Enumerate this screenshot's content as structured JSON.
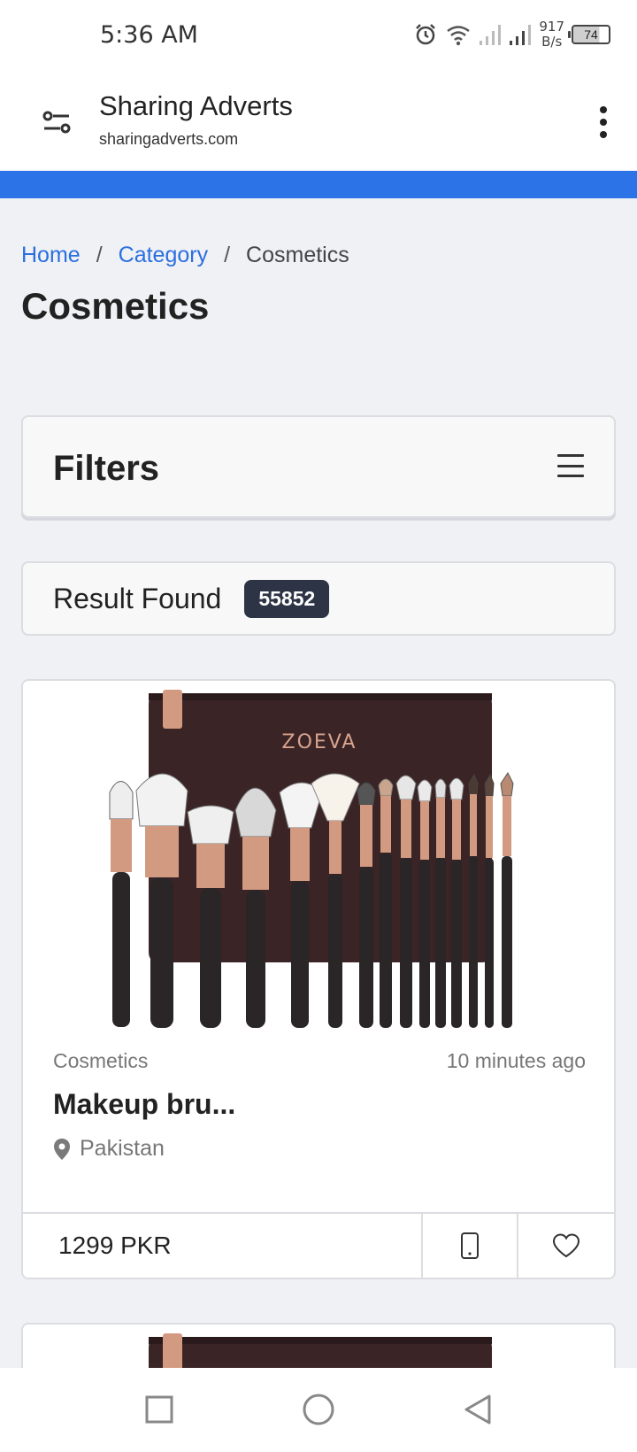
{
  "status_bar": {
    "time": "5:36 AM",
    "net_speed_value": "917",
    "net_speed_unit": "B/s",
    "battery": "74",
    "icons": [
      "alarm-icon",
      "wifi-icon",
      "signal-icon",
      "signal-icon",
      "battery-icon"
    ]
  },
  "browser": {
    "site_title": "Sharing Adverts",
    "site_url": "sharingadverts.com",
    "accent_color": "#2d73e8"
  },
  "breadcrumb": {
    "home": "Home",
    "category": "Category",
    "current": "Cosmetics",
    "separator": "/"
  },
  "page": {
    "title": "Cosmetics"
  },
  "filters": {
    "title": "Filters"
  },
  "results": {
    "label": "Result Found",
    "count": "55852"
  },
  "products": [
    {
      "category": "Cosmetics",
      "time_ago": "10 minutes ago",
      "title": "Makeup bru...",
      "location": "Pakistan",
      "price": "1299 PKR",
      "image_brand": "ZOEVA"
    }
  ],
  "nav": {
    "buttons": [
      "recent-apps-button",
      "home-button",
      "back-button"
    ]
  }
}
